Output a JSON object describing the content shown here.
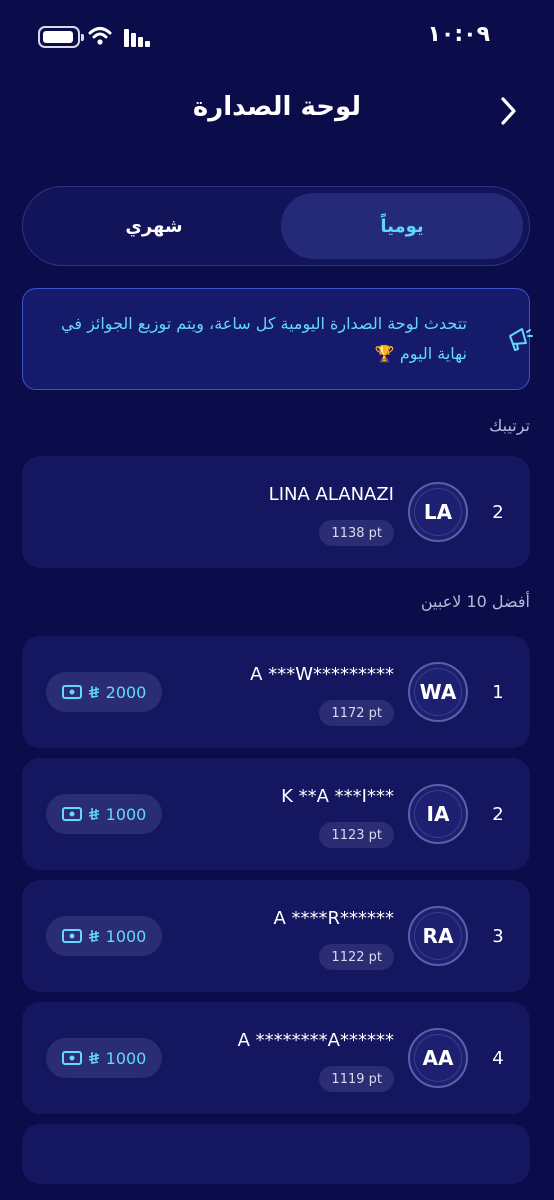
{
  "status_bar": {
    "time": "١٠:٠٩"
  },
  "header": {
    "title": "لوحة الصدارة"
  },
  "tabs": {
    "daily": "يومياً",
    "monthly": "شهري"
  },
  "banner": {
    "text": "تتحدث لوحة الصدارة اليومية كل ساعة، ويتم توزيع الجوائز في نهاية اليوم 🏆"
  },
  "my_rank": {
    "label": "ترتيبك",
    "rank": "2",
    "initials": "LA",
    "name": "LINA ALANAZI",
    "points": "1138 pt"
  },
  "top_players": {
    "label": "أفضل 10 لاعبين",
    "rows": [
      {
        "rank": "1",
        "initials": "WA",
        "name": "A ***W*********",
        "points": "1172 pt",
        "prize": "2000"
      },
      {
        "rank": "2",
        "initials": "IA",
        "name": "K **A ***I***",
        "points": "1123 pt",
        "prize": "1000"
      },
      {
        "rank": "3",
        "initials": "RA",
        "name": "A ****R******",
        "points": "1122 pt",
        "prize": "1000"
      },
      {
        "rank": "4",
        "initials": "AA",
        "name": "A ********A******",
        "points": "1119 pt",
        "prize": "1000"
      }
    ]
  },
  "colors": {
    "background": "#0b0c4a",
    "card": "#151660",
    "accent": "#5fd6ff"
  },
  "icons": [
    "battery-icon",
    "wifi-icon",
    "signal-icon",
    "chevron-right-icon",
    "megaphone-icon",
    "money-icon",
    "riyal-icon"
  ]
}
